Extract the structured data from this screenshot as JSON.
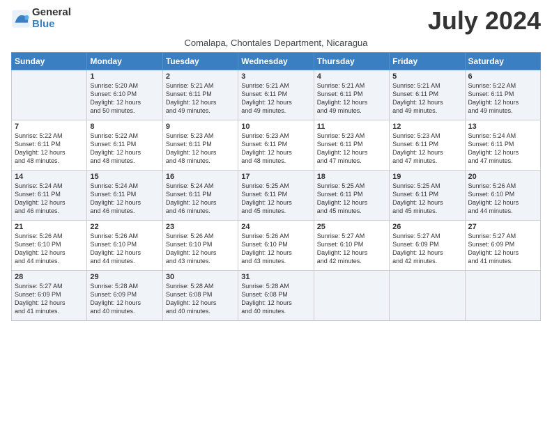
{
  "logo": {
    "line1": "General",
    "line2": "Blue"
  },
  "title": "July 2024",
  "subtitle": "Comalapa, Chontales Department, Nicaragua",
  "days_of_week": [
    "Sunday",
    "Monday",
    "Tuesday",
    "Wednesday",
    "Thursday",
    "Friday",
    "Saturday"
  ],
  "weeks": [
    [
      {
        "day": "",
        "content": ""
      },
      {
        "day": "1",
        "content": "Sunrise: 5:20 AM\nSunset: 6:10 PM\nDaylight: 12 hours\nand 50 minutes."
      },
      {
        "day": "2",
        "content": "Sunrise: 5:21 AM\nSunset: 6:11 PM\nDaylight: 12 hours\nand 49 minutes."
      },
      {
        "day": "3",
        "content": "Sunrise: 5:21 AM\nSunset: 6:11 PM\nDaylight: 12 hours\nand 49 minutes."
      },
      {
        "day": "4",
        "content": "Sunrise: 5:21 AM\nSunset: 6:11 PM\nDaylight: 12 hours\nand 49 minutes."
      },
      {
        "day": "5",
        "content": "Sunrise: 5:21 AM\nSunset: 6:11 PM\nDaylight: 12 hours\nand 49 minutes."
      },
      {
        "day": "6",
        "content": "Sunrise: 5:22 AM\nSunset: 6:11 PM\nDaylight: 12 hours\nand 49 minutes."
      }
    ],
    [
      {
        "day": "7",
        "content": "Sunrise: 5:22 AM\nSunset: 6:11 PM\nDaylight: 12 hours\nand 48 minutes."
      },
      {
        "day": "8",
        "content": "Sunrise: 5:22 AM\nSunset: 6:11 PM\nDaylight: 12 hours\nand 48 minutes."
      },
      {
        "day": "9",
        "content": "Sunrise: 5:23 AM\nSunset: 6:11 PM\nDaylight: 12 hours\nand 48 minutes."
      },
      {
        "day": "10",
        "content": "Sunrise: 5:23 AM\nSunset: 6:11 PM\nDaylight: 12 hours\nand 48 minutes."
      },
      {
        "day": "11",
        "content": "Sunrise: 5:23 AM\nSunset: 6:11 PM\nDaylight: 12 hours\nand 47 minutes."
      },
      {
        "day": "12",
        "content": "Sunrise: 5:23 AM\nSunset: 6:11 PM\nDaylight: 12 hours\nand 47 minutes."
      },
      {
        "day": "13",
        "content": "Sunrise: 5:24 AM\nSunset: 6:11 PM\nDaylight: 12 hours\nand 47 minutes."
      }
    ],
    [
      {
        "day": "14",
        "content": "Sunrise: 5:24 AM\nSunset: 6:11 PM\nDaylight: 12 hours\nand 46 minutes."
      },
      {
        "day": "15",
        "content": "Sunrise: 5:24 AM\nSunset: 6:11 PM\nDaylight: 12 hours\nand 46 minutes."
      },
      {
        "day": "16",
        "content": "Sunrise: 5:24 AM\nSunset: 6:11 PM\nDaylight: 12 hours\nand 46 minutes."
      },
      {
        "day": "17",
        "content": "Sunrise: 5:25 AM\nSunset: 6:11 PM\nDaylight: 12 hours\nand 45 minutes."
      },
      {
        "day": "18",
        "content": "Sunrise: 5:25 AM\nSunset: 6:11 PM\nDaylight: 12 hours\nand 45 minutes."
      },
      {
        "day": "19",
        "content": "Sunrise: 5:25 AM\nSunset: 6:11 PM\nDaylight: 12 hours\nand 45 minutes."
      },
      {
        "day": "20",
        "content": "Sunrise: 5:26 AM\nSunset: 6:10 PM\nDaylight: 12 hours\nand 44 minutes."
      }
    ],
    [
      {
        "day": "21",
        "content": "Sunrise: 5:26 AM\nSunset: 6:10 PM\nDaylight: 12 hours\nand 44 minutes."
      },
      {
        "day": "22",
        "content": "Sunrise: 5:26 AM\nSunset: 6:10 PM\nDaylight: 12 hours\nand 44 minutes."
      },
      {
        "day": "23",
        "content": "Sunrise: 5:26 AM\nSunset: 6:10 PM\nDaylight: 12 hours\nand 43 minutes."
      },
      {
        "day": "24",
        "content": "Sunrise: 5:26 AM\nSunset: 6:10 PM\nDaylight: 12 hours\nand 43 minutes."
      },
      {
        "day": "25",
        "content": "Sunrise: 5:27 AM\nSunset: 6:10 PM\nDaylight: 12 hours\nand 42 minutes."
      },
      {
        "day": "26",
        "content": "Sunrise: 5:27 AM\nSunset: 6:09 PM\nDaylight: 12 hours\nand 42 minutes."
      },
      {
        "day": "27",
        "content": "Sunrise: 5:27 AM\nSunset: 6:09 PM\nDaylight: 12 hours\nand 41 minutes."
      }
    ],
    [
      {
        "day": "28",
        "content": "Sunrise: 5:27 AM\nSunset: 6:09 PM\nDaylight: 12 hours\nand 41 minutes."
      },
      {
        "day": "29",
        "content": "Sunrise: 5:28 AM\nSunset: 6:09 PM\nDaylight: 12 hours\nand 40 minutes."
      },
      {
        "day": "30",
        "content": "Sunrise: 5:28 AM\nSunset: 6:08 PM\nDaylight: 12 hours\nand 40 minutes."
      },
      {
        "day": "31",
        "content": "Sunrise: 5:28 AM\nSunset: 6:08 PM\nDaylight: 12 hours\nand 40 minutes."
      },
      {
        "day": "",
        "content": ""
      },
      {
        "day": "",
        "content": ""
      },
      {
        "day": "",
        "content": ""
      }
    ]
  ]
}
